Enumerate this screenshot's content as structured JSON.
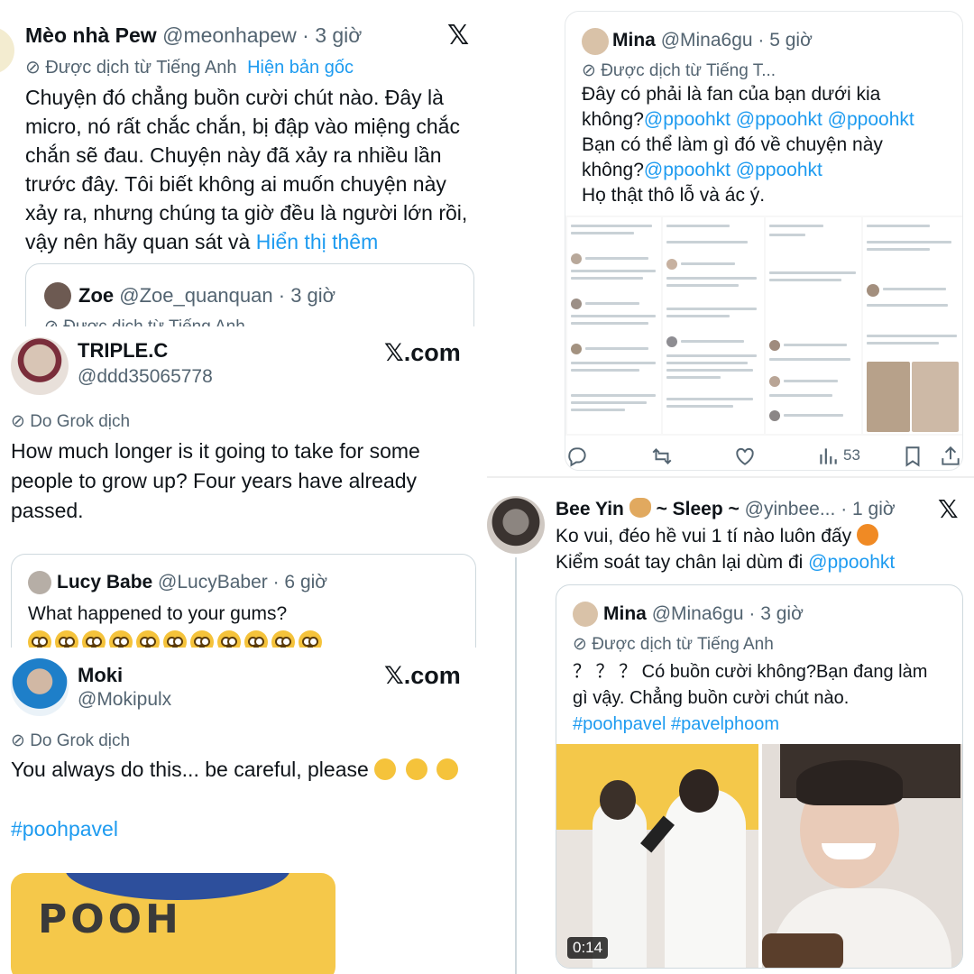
{
  "p1": {
    "name": "Mèo nhà Pew",
    "handle": "@meonhapew",
    "time": "· 3 giờ",
    "translated_label": "Được dịch từ Tiếng Anh",
    "show_original": "Hiện bản gốc",
    "body": "Chuyện đó chẳng buồn cười chút nào. Đây là micro, nó rất chắc chắn, bị đập vào miệng chắc chắn sẽ đau. Chuyện này đã xảy ra nhiều lần trước đây. Tôi biết không ai muốn chuyện này xảy ra, nhưng chúng ta giờ đều là người lớn rồi, vậy nên hãy quan sát và",
    "show_more": "Hiển thị thêm",
    "quote": {
      "name": "Zoe",
      "handle": "@Zoe_quanquan",
      "time": "· 3 giờ",
      "translated_label": "Được dịch từ Tiếng Anh"
    }
  },
  "p2": {
    "name": "Mina",
    "handle": "@Mina6gu",
    "time": "· 5 giờ",
    "translated_label": "Được dịch từ Tiếng T...",
    "line1": "Đây có phải là fan của bạn dưới kia",
    "line2_text": "không?",
    "line2_mentions": "@ppoohkt @ppoohkt @ppoohkt",
    "line3": "Bạn có thể làm gì đó về chuyện này",
    "line4_text": "không?",
    "line4_mentions": "@ppoohkt @ppoohkt",
    "line5": "Họ thật thô lỗ và ác ý.",
    "views": "53"
  },
  "p3": {
    "name": "TRIPLE.C",
    "handle": "@ddd35065778",
    "site": "𝕏.com",
    "grok_label": "Do Grok dịch",
    "body": "How much longer is it going to take for some people to grow up? Four years have already passed.",
    "quote": {
      "name": "Lucy Babe",
      "handle": "@LucyBaber",
      "time": "· 6 giờ",
      "text": "What happened to your gums?"
    }
  },
  "p4": {
    "name": "Bee Yin",
    "name_suffix": "~ Sleep ~",
    "handle": "@yinbee...",
    "time": "· 1 giờ",
    "line1": "Ko vui, đéo hề vui 1 tí nào luôn đấy",
    "line2": "Kiểm soát tay chân lại dùm đi",
    "mention": "@ppoohkt",
    "quote": {
      "name": "Mina",
      "handle": "@Mina6gu",
      "time": "· 3 giờ",
      "translated_label": "Được dịch từ Tiếng Anh",
      "line1": "？ ？ ？ Có buồn cười không?Bạn đang làm",
      "line2": "gì vậy. Chẳng buồn cười chút nào.",
      "hashtags": "#poohpavel #pavelphoom",
      "video_time": "0:14"
    }
  },
  "p5": {
    "name": "Moki",
    "handle": "@Mokipulx",
    "site": "𝕏.com",
    "grok_label": "Do Grok dịch",
    "body": "You always do this... be careful, please",
    "hashtag": "#poohpavel",
    "image_text": "POOH"
  },
  "colors": {
    "link": "#1d9bf0",
    "muted": "#536471",
    "text": "#0f1419",
    "border": "#cfd9de"
  }
}
